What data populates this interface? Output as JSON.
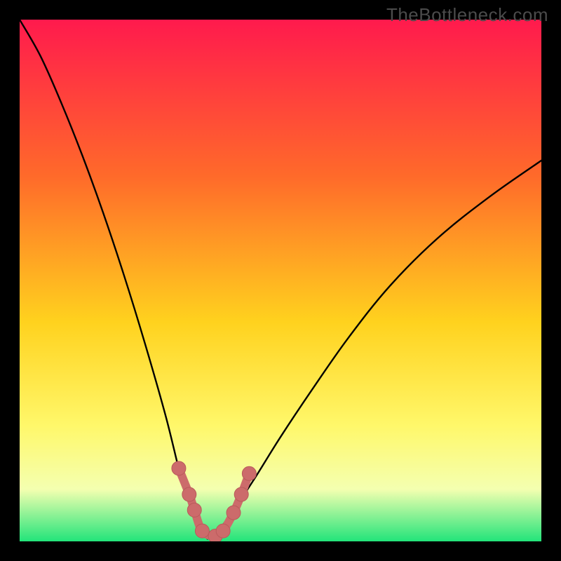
{
  "watermark": "TheBottleneck.com",
  "colors": {
    "frame": "#000000",
    "grad_top": "#ff1a4d",
    "grad_mid1": "#ff6a2a",
    "grad_mid2": "#ffd21e",
    "grad_mid3": "#fff86b",
    "grad_mid4": "#f4ffb0",
    "grad_bottom": "#22e47a",
    "curve": "#000000",
    "marker_fill": "#cc6b6b",
    "marker_stroke": "#b95a5a"
  },
  "chart_data": {
    "type": "line",
    "title": "",
    "xlabel": "",
    "ylabel": "",
    "xlim": [
      0,
      100
    ],
    "ylim": [
      0,
      100
    ],
    "grid": false,
    "legend": null,
    "note": "No axes or tick labels visible; x/y interpreted as 0–100% of plot area. Lower y = bottom (green/low bottleneck), higher y = top (red/high bottleneck). Minimum of the V-curve near x≈36.",
    "series": [
      {
        "name": "left-branch",
        "x": [
          0,
          4,
          8,
          12,
          16,
          20,
          24,
          28,
          31,
          33,
          35,
          36
        ],
        "y": [
          100,
          93,
          84,
          74,
          63,
          51,
          38,
          24,
          12,
          6,
          2,
          0.5
        ]
      },
      {
        "name": "right-branch",
        "x": [
          36,
          38,
          41,
          45,
          50,
          56,
          63,
          71,
          80,
          90,
          100
        ],
        "y": [
          0.5,
          2,
          6,
          12,
          20,
          29,
          39,
          49,
          58,
          66,
          73
        ]
      },
      {
        "name": "highlight-markers",
        "kind": "points+segments",
        "x": [
          30.5,
          32.5,
          33.5,
          35.0,
          37.5,
          39.0,
          41.0,
          42.5,
          44.0
        ],
        "y": [
          14.0,
          9.0,
          6.0,
          2.0,
          1.0,
          2.0,
          5.5,
          9.0,
          13.0
        ]
      }
    ]
  }
}
